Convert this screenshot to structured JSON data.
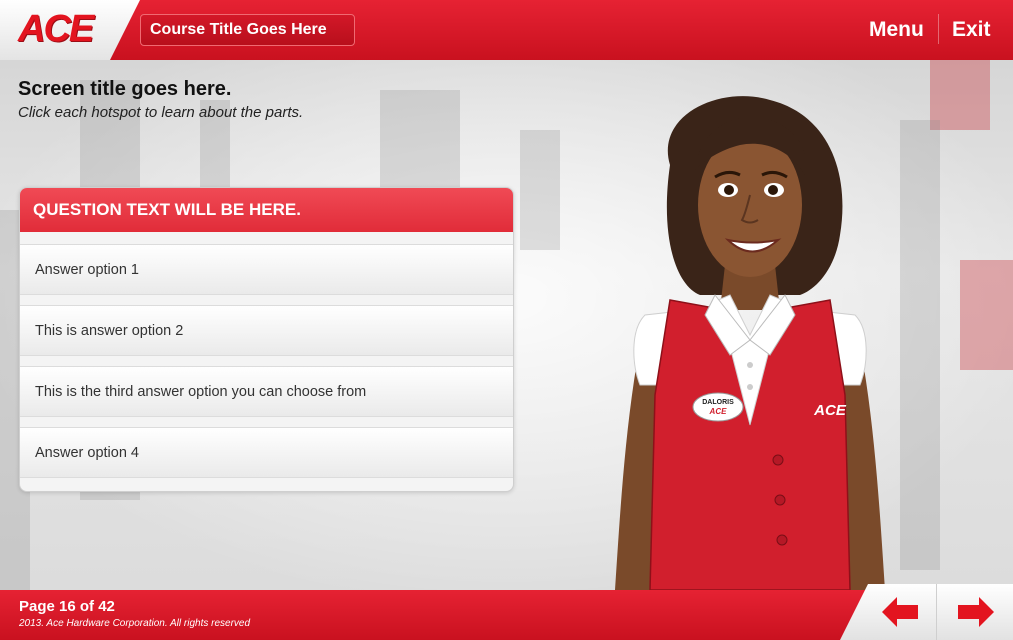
{
  "header": {
    "logo_text": "ACE",
    "course_title": "Course Title Goes Here",
    "menu_label": "Menu",
    "exit_label": "Exit"
  },
  "screen": {
    "title": "Screen title goes here.",
    "subtitle": "Click each hotspot to learn about the parts."
  },
  "question": {
    "text": "QUESTION TEXT WILL BE HERE.",
    "answers": [
      "Answer option 1",
      "This is answer option 2",
      "This is the third answer option you can choose from",
      "Answer option 4"
    ]
  },
  "character": {
    "name_badge": "DALORIS",
    "badge_logo": "ACE",
    "vest_logo": "ACE"
  },
  "footer": {
    "page_label": "Page 16 of 42",
    "copyright": "2013. Ace Hardware Corporation. All rights reserved"
  },
  "navigation": {
    "prev_icon": "left-arrow-icon",
    "next_icon": "right-arrow-icon"
  },
  "colors": {
    "brand_red": "#e3141f",
    "header_red": "#d31828",
    "question_header": "#e8343f"
  }
}
